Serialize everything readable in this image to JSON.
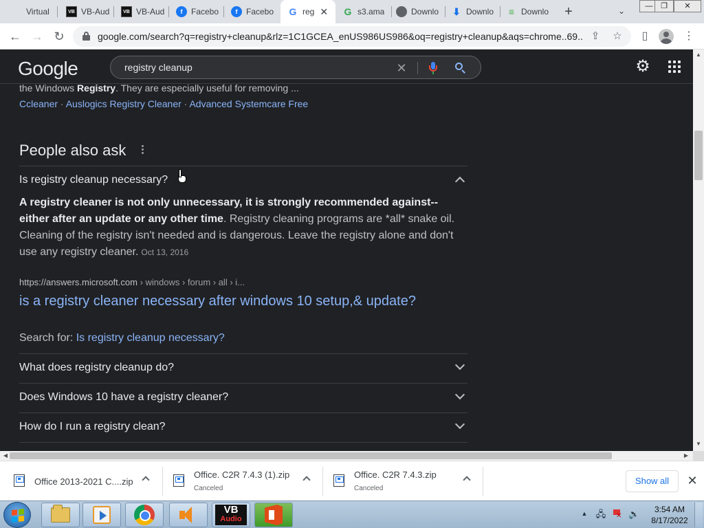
{
  "browser": {
    "tabs": [
      {
        "title": "Virtual",
        "icon": "none-icon"
      },
      {
        "title": "VB-Aud",
        "icon": "vb-audio-icon"
      },
      {
        "title": "VB-Aud",
        "icon": "vb-audio-icon"
      },
      {
        "title": "Facebo",
        "icon": "facebook-icon"
      },
      {
        "title": "Facebo",
        "icon": "facebook-icon"
      },
      {
        "title": "reg",
        "icon": "google-icon",
        "active": true
      },
      {
        "title": "s3.ama",
        "icon": "s3-icon"
      },
      {
        "title": "Downlo",
        "icon": "globe-icon"
      },
      {
        "title": "Downlo",
        "icon": "download-icon"
      },
      {
        "title": "Downlo",
        "icon": "lines-icon"
      }
    ],
    "url": "google.com/search?q=registry+cleanup&rlz=1C1GCEA_enUS986US986&oq=registry+cleanup&aqs=chrome..69..."
  },
  "google": {
    "logo_letters": [
      {
        "ch": "G",
        "color": "#e8eaed"
      },
      {
        "ch": "o",
        "color": "#e8eaed"
      },
      {
        "ch": "o",
        "color": "#e8eaed"
      },
      {
        "ch": "g",
        "color": "#e8eaed"
      },
      {
        "ch": "l",
        "color": "#e8eaed"
      },
      {
        "ch": "e",
        "color": "#e8eaed"
      }
    ],
    "query": "registry cleanup"
  },
  "results": {
    "snippet_prefix": "the Windows ",
    "snippet_bold": "Registry",
    "snippet_suffix": ". They are especially useful for removing ...",
    "related_links": [
      "Ccleaner",
      "Auslogics Registry Cleaner",
      "Advanced Systemcare Free"
    ],
    "paa_title": "People also ask",
    "expanded_question": "Is registry cleanup necessary?",
    "answer_bold": "A registry cleaner is not only unnecessary, it is strongly recommended against--either after an update or any other time",
    "answer_rest": ". Registry cleaning programs are *all* snake oil. Cleaning of the registry isn't needed and is dangerous. Leave the registry alone and don't use any registry cleaner.",
    "answer_date": "Oct 13, 2016",
    "cite_domain": "https://answers.microsoft.com",
    "cite_path": " › windows › forum › all › i...",
    "result_title": "is a registry cleaner necessary after windows 10 setup,& update?",
    "search_for_label": "Search for: ",
    "search_for_link": "Is registry cleanup necessary?",
    "collapsed_questions": [
      "What does registry cleanup do?",
      "Does Windows 10 have a registry cleaner?",
      "How do I run a registry clean?"
    ]
  },
  "downloads": {
    "items": [
      {
        "name": "Office 2013-2021 C....zip",
        "status": ""
      },
      {
        "name": "Office. C2R 7.4.3 (1).zip",
        "status": "Canceled"
      },
      {
        "name": "Office. C2R 7.4.3.zip",
        "status": "Canceled"
      }
    ],
    "show_all": "Show all"
  },
  "taskbar": {
    "vb_label": "VB",
    "vb_sub": "Audio",
    "time": "3:54 AM",
    "date": "8/17/2022"
  },
  "colors": {
    "link": "#8ab4f8",
    "page_bg": "#202124",
    "text": "#bdc1c6"
  }
}
